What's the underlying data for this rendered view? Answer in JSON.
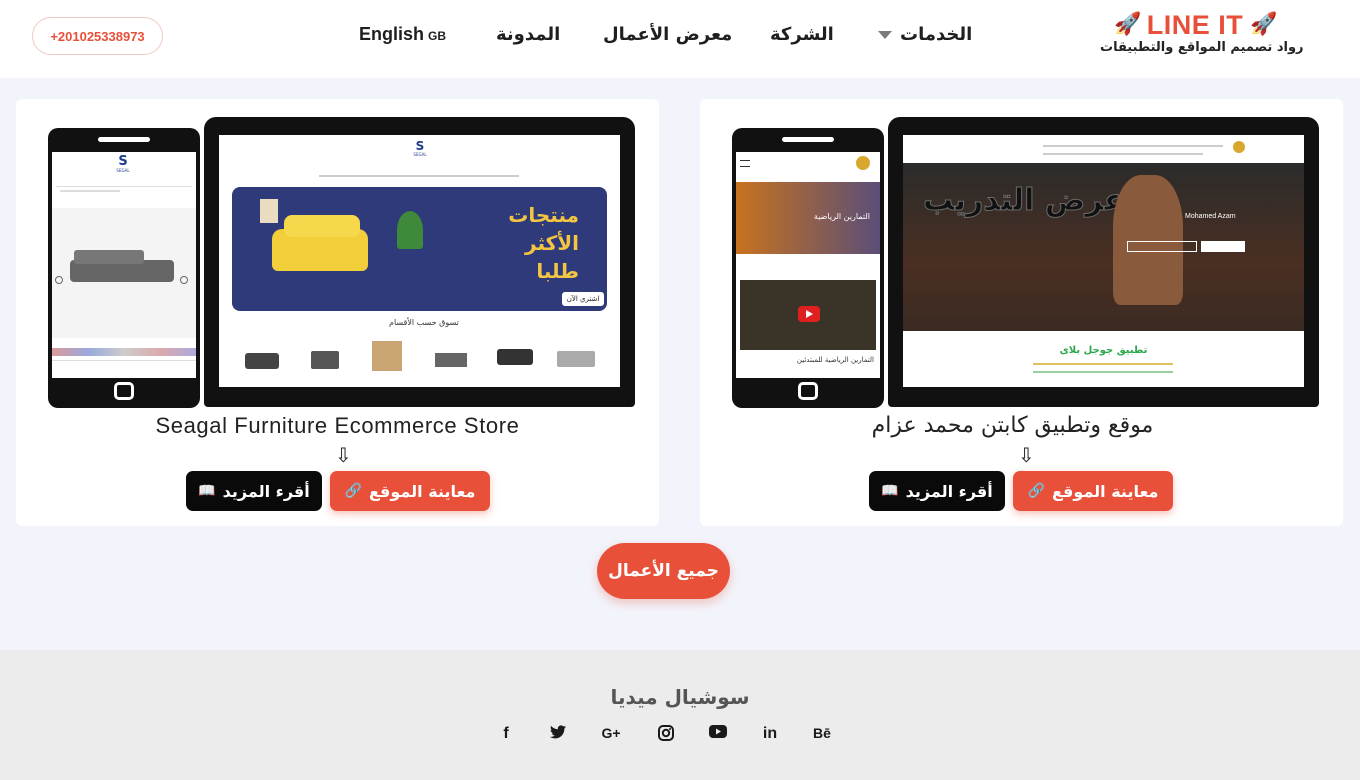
{
  "header": {
    "phone": "+201025338973",
    "nav": {
      "lang": "English",
      "lang_code": "GB",
      "blog": "المدونة",
      "portfolio": "معرض الأعمال",
      "company": "الشركة",
      "services": "الخدمات"
    },
    "logo": {
      "name": "LINE IT",
      "tagline": "رواد تصميم المواقع والتطبيقات"
    }
  },
  "projects": [
    {
      "title": "Seagal Furniture Ecommerce Store",
      "preview_label": "معاينة الموقع",
      "read_more_label": "أقرء المزيد",
      "mock": {
        "brand": "SEGAL",
        "banner_line1": "منتجات",
        "banner_line2": "الأكثر",
        "banner_line3": "طلبا",
        "banner_cta": "اشتري الآن",
        "section_title": "تسوق حسب الأقسام"
      }
    },
    {
      "title": "موقع  وتطبيق كابتن محمد عزام",
      "preview_label": "معاينة الموقع",
      "read_more_label": "أقرء المزيد",
      "mock": {
        "hero_name": "Mohamed Azam",
        "hero_big": "عرض التدريب",
        "app_title": "تطبيق جوجل بلاى",
        "phone_banner": "التمارين الرياضية",
        "phone_video_title": "التمارين الرياضية للمبتدئين"
      }
    }
  ],
  "all_works_label": "جميع الأعمال",
  "footer": {
    "social_title": "سوشيال ميديا",
    "icons": [
      "facebook-icon",
      "twitter-icon",
      "google-plus-icon",
      "instagram-icon",
      "youtube-icon",
      "linkedin-icon",
      "behance-icon"
    ]
  },
  "colors": {
    "accent": "#e8503a",
    "background": "#f2f4fb",
    "dark_button": "#0a0a0a"
  }
}
